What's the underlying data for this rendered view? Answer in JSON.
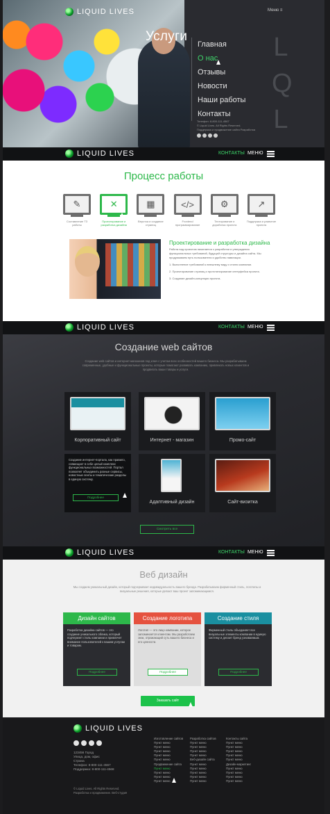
{
  "brand": {
    "name": "LIQUID LIVES"
  },
  "hero": {
    "title": "Услуги",
    "menu_label": "Меню ≡",
    "nav": [
      "Главная",
      "О нас",
      "Отзывы",
      "Новости",
      "Наши работы",
      "Контакты"
    ],
    "lql": [
      "L",
      "Q",
      "L"
    ],
    "contacts": [
      "Телефон: 8-800-111-4567",
      "© Liquid Lives. All Rights Reserved.",
      "Поддержка и продвижение сайта Разработка"
    ]
  },
  "bar": {
    "contacts": "КОНТАКТЫ",
    "menu": "МЕНЮ"
  },
  "process": {
    "title": "Процесс работы",
    "steps": [
      {
        "icon": "✎",
        "label": "Составление ТЗ работы"
      },
      {
        "icon": "✕",
        "label": "Проектирование и разработка дизайна"
      },
      {
        "icon": "▦",
        "label": "Верстка и создание страниц"
      },
      {
        "icon": "</>",
        "label": "Frontend программирование"
      },
      {
        "icon": "⚙",
        "label": "Тестирование и доработка проекта"
      },
      {
        "icon": "↗",
        "label": "Поддержка и развитие проекта"
      }
    ],
    "detail_title": "Проектирование и разработка дизайна",
    "detail_paragraphs": [
      "Работа над проектом начинается с разработки и утверждения функциональных требований, будущей структуры и дизайна сайта. Мы продумываем путь пользователя и удобство навигации.",
      "1. Выполнение требований к внешнему виду и стилю компании.",
      "2. Проектирование страниц и прототипирование интерфейса проекта.",
      "3. Создание дизайн-концепции проекта."
    ]
  },
  "web": {
    "title": "Создание web сайтов",
    "intro": "Создание web сайтов и интернет-магазинов под ключ с учетом всех особенностей вашего бизнеса. Мы разрабатываем современные, удобные и функциональные проекты, которые помогают развивать компанию, привлекать новых клиентов и продвигать ваши товары и услуги.",
    "tiles": [
      {
        "caption": "Корпоративный сайт"
      },
      {
        "caption": "Интернет - магазин"
      },
      {
        "caption": "Промо-сайт"
      },
      {
        "caption": "Адаптивный дизайн"
      },
      {
        "caption": "Сайт-визитка"
      }
    ],
    "hover_text": "Создание интернет-портала, как правило, совмещает в себе целый комплекс функциональных возможностей. Портал позволяет объединить разные сервисы, новостные ленты и тематические разделы в единую систему.",
    "hover_button": "Подробнее",
    "all_button": "Смотреть все"
  },
  "webdesign": {
    "title": "Веб дизайн",
    "intro": "Мы создаем уникальный дизайн, который подчеркивает индивидуальность вашего бренда. Разрабатываем фирменный стиль, логотипы и визуальные решения, которые делают ваш проект запоминающимся.",
    "cards": [
      {
        "title": "Дизайн сайтов",
        "text": "Разработка дизайна сайтов — это создание уникального облика, который подчеркнет стиль компании и привлечет внимание пользователей к вашим услугам и товарам.",
        "button": "Подробнее",
        "color": "#2db84a"
      },
      {
        "title": "Создание логотипа",
        "text": "Логотип — это лицо компании, которое запоминается клиентам. Мы разработаем знак, отражающий суть вашего бизнеса и его ценности.",
        "button": "Подробнее",
        "color": "#e5523f"
      },
      {
        "title": "Создание стиля",
        "text": "Фирменный стиль объединяет все визуальные элементы компании в единую систему и делает бренд узнаваемым.",
        "button": "Подробнее",
        "color": "#1a8fa0"
      }
    ],
    "order_button": "Заказать сайт"
  },
  "footer": {
    "address": [
      "123456 Город",
      "Улица, дом, офис",
      "Страна",
      "Телефон: 8-800-111-4567",
      "Поддержка: 8-800-111-4568"
    ],
    "copyright": [
      "© Liquid Lives. All Rights Reserved.",
      "Разработка и продвижение. Веб-студия"
    ],
    "col1": [
      "Изготовление сайтов",
      "Пункт меню",
      "Пункт меню",
      "Пункт меню",
      "Пункт меню",
      "Пункт меню",
      "Продвижение сайта",
      "Пункт меню",
      "Пункт меню",
      "Пункт меню",
      "Пункт меню"
    ],
    "col2": [
      "Разработка сайтов",
      "Пункт меню",
      "Пункт меню",
      "Пункт меню",
      "Пункт меню",
      "Веб-дизайн сайта",
      "Пункт меню",
      "Пункт меню",
      "Пункт меню",
      "Пункт меню",
      "Пункт меню"
    ],
    "col3": [
      "Контакты сайта",
      "Пункт меню",
      "Пункт меню",
      "Пункт меню",
      "Пункт меню",
      "Пункт меню",
      "Дизайн-маркетинг",
      "Пункт меню",
      "Пункт меню",
      "Пункт меню",
      "Пункт меню"
    ]
  },
  "colors": {
    "accent": "#2db84a",
    "dark": "#111214",
    "card_red": "#e5523f",
    "card_teal": "#1a8fa0"
  }
}
